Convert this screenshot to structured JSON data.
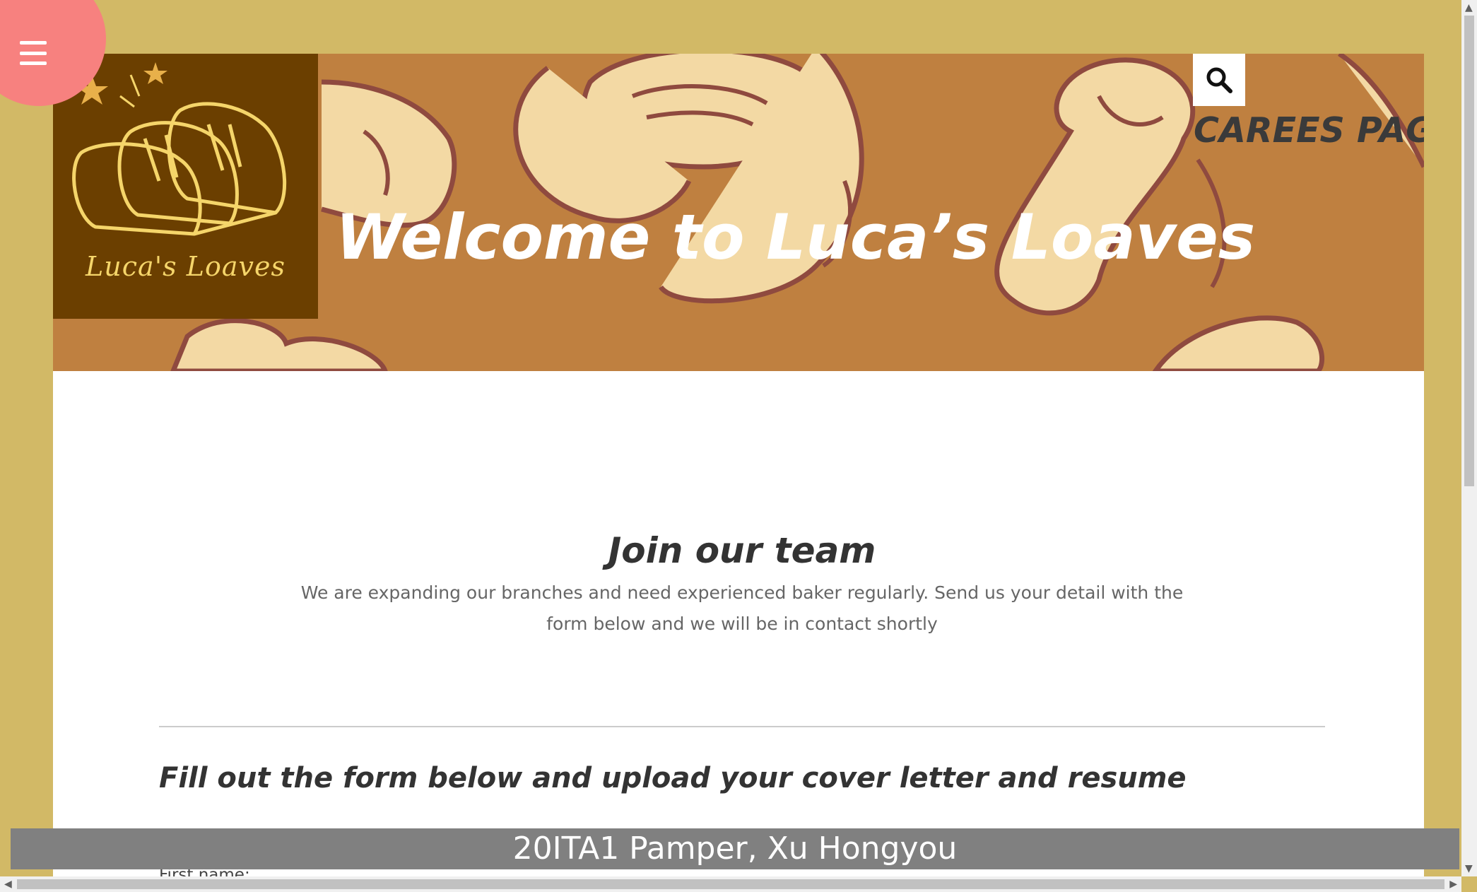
{
  "menu": {
    "icon": "hamburger-menu-icon"
  },
  "header": {
    "logo_text": "Luca's Loaves",
    "title": "Welcome to Luca’s Loaves",
    "search_icon": "search-icon",
    "page_label": "CAREES PAGE"
  },
  "main": {
    "join_title": "Join our team",
    "join_description": "We are expanding our branches and need experienced baker regularly. Send us your detail with the form below and we will be in contact shortly",
    "form_title": "Fill out the form below and upload your cover letter and resume",
    "first_name_label": "First name:"
  },
  "footer": {
    "text": "20ITA1 Pamper, Xu Hongyou"
  },
  "colors": {
    "page_background": "#d2b966",
    "banner": "#bf8040",
    "logo_background": "#6b3f00",
    "menu_circle": "#f7817f",
    "footer_bar": "#808080"
  }
}
